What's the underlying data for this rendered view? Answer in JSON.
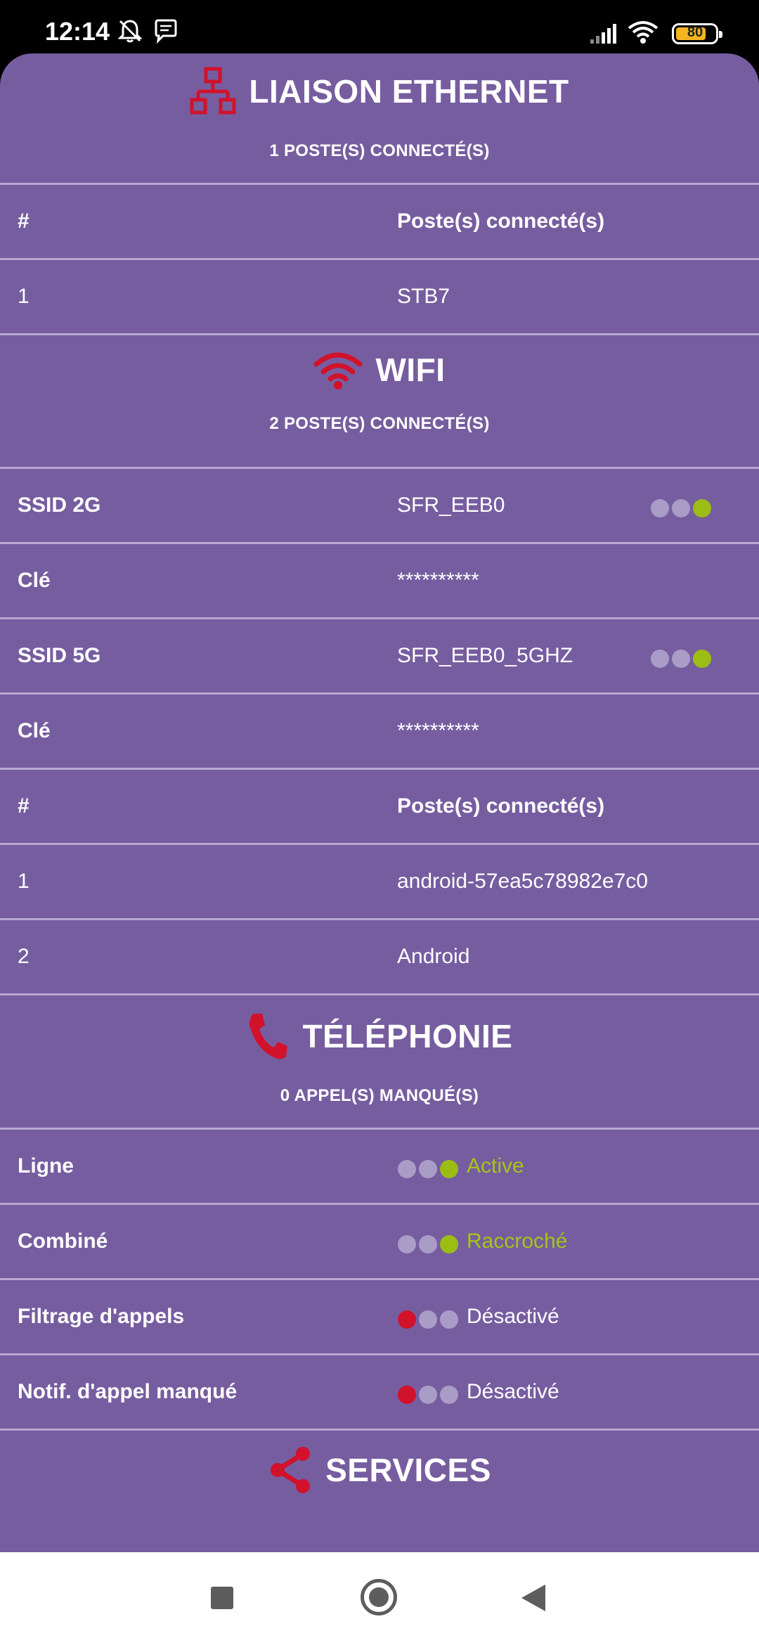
{
  "status_bar": {
    "time": "12:14",
    "battery": "80"
  },
  "colors": {
    "background": "#765da0",
    "accent_red": "#d1122a",
    "status_green": "#9cbd14",
    "dot_idle": "#a99cc6"
  },
  "ethernet": {
    "title": "LIAISON ETHERNET",
    "subtitle": "1 POSTE(S) CONNECTÉ(S)",
    "icon": "network-icon",
    "header": {
      "col1": "#",
      "col2": "Poste(s) connecté(s)"
    },
    "rows": [
      {
        "num": "1",
        "name": "STB7"
      }
    ]
  },
  "wifi": {
    "title": "WIFI",
    "subtitle": "2 POSTE(S) CONNECTÉ(S)",
    "icon": "wifi-icon",
    "ssid2g": {
      "label": "SSID 2G",
      "value": "SFR_EEB0"
    },
    "key2g": {
      "label": "Clé",
      "value": "**********"
    },
    "ssid5g": {
      "label": "SSID 5G",
      "value": "SFR_EEB0_5GHZ"
    },
    "key5g": {
      "label": "Clé",
      "value": "**********"
    },
    "header": {
      "col1": "#",
      "col2": "Poste(s) connecté(s)"
    },
    "rows": [
      {
        "num": "1",
        "name": "android-57ea5c78982e7c0"
      },
      {
        "num": "2",
        "name": "Android"
      }
    ]
  },
  "telephony": {
    "title": "TÉLÉPHONIE",
    "subtitle": "0 APPEL(S) MANQUÉ(S)",
    "icon": "phone-icon",
    "rows": [
      {
        "label": "Ligne",
        "status": "Active"
      },
      {
        "label": "Combiné",
        "status": "Raccroché"
      },
      {
        "label": "Filtrage d'appels",
        "status": "Désactivé"
      },
      {
        "label": "Notif. d'appel manqué",
        "status": "Désactivé"
      }
    ]
  },
  "services": {
    "title": "SERVICES",
    "icon": "share-icon"
  }
}
